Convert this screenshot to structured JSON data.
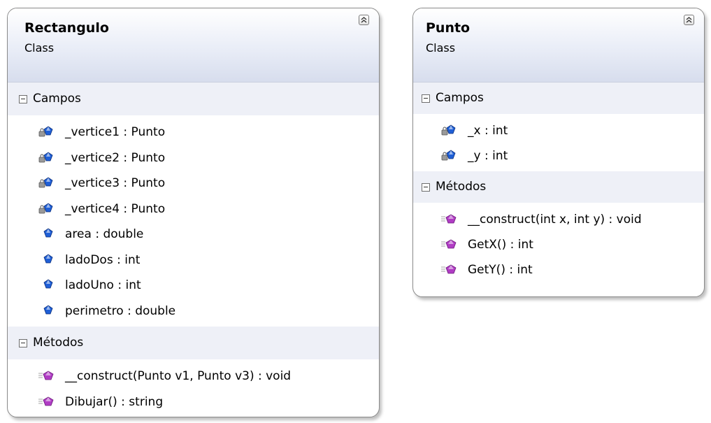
{
  "classes": [
    {
      "name": "Rectangulo",
      "kind": "Class",
      "sections": [
        {
          "title": "Campos",
          "members": [
            {
              "text": "_vertice1 : Punto",
              "icon": "private-field-icon"
            },
            {
              "text": "_vertice2 : Punto",
              "icon": "private-field-icon"
            },
            {
              "text": "_vertice3 : Punto",
              "icon": "private-field-icon"
            },
            {
              "text": "_vertice4 : Punto",
              "icon": "private-field-icon"
            },
            {
              "text": "area : double",
              "icon": "field-icon"
            },
            {
              "text": "ladoDos : int",
              "icon": "field-icon"
            },
            {
              "text": "ladoUno : int",
              "icon": "field-icon"
            },
            {
              "text": "perimetro : double",
              "icon": "field-icon"
            }
          ]
        },
        {
          "title": "Métodos",
          "members": [
            {
              "text": "__construct(Punto v1, Punto v3) : void",
              "icon": "method-icon"
            },
            {
              "text": "Dibujar() : string",
              "icon": "method-icon"
            }
          ]
        }
      ]
    },
    {
      "name": "Punto",
      "kind": "Class",
      "sections": [
        {
          "title": "Campos",
          "members": [
            {
              "text": "_x : int",
              "icon": "private-field-icon"
            },
            {
              "text": "_y : int",
              "icon": "private-field-icon"
            }
          ]
        },
        {
          "title": "Métodos",
          "members": [
            {
              "text": "__construct(int x, int y) : void",
              "icon": "method-icon"
            },
            {
              "text": "GetX() : int",
              "icon": "method-icon"
            },
            {
              "text": "GetY() : int",
              "icon": "method-icon"
            }
          ]
        }
      ]
    }
  ],
  "colors": {
    "field_blue": "#1f5fd6",
    "method_purple": "#b03cc4",
    "header_gradient_end": "#d7dded",
    "section_bg": "#eef0f7"
  }
}
